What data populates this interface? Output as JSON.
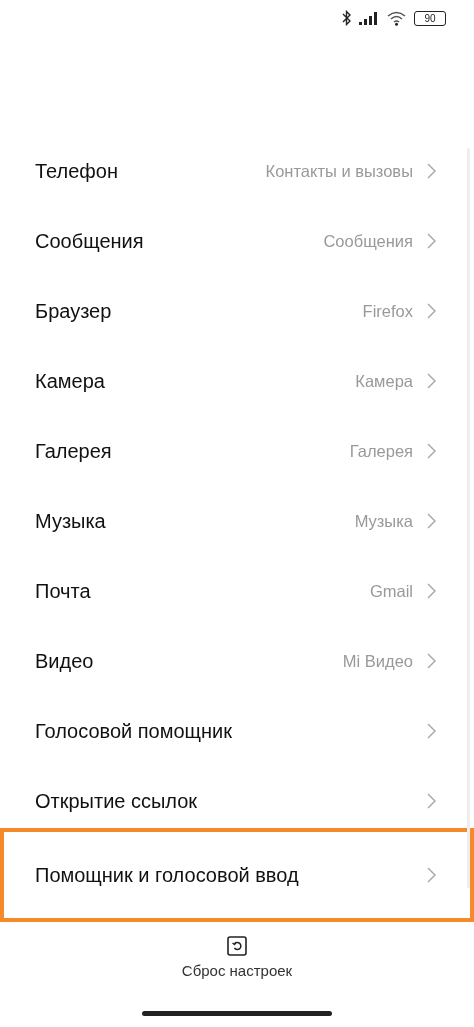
{
  "status_bar": {
    "battery": "90"
  },
  "items": [
    {
      "label": "Телефон",
      "value": "Контакты и вызовы",
      "highlighted": false
    },
    {
      "label": "Сообщения",
      "value": "Сообщения",
      "highlighted": false
    },
    {
      "label": "Браузер",
      "value": "Firefox",
      "highlighted": false
    },
    {
      "label": "Камера",
      "value": "Камера",
      "highlighted": false
    },
    {
      "label": "Галерея",
      "value": "Галерея",
      "highlighted": false
    },
    {
      "label": "Музыка",
      "value": "Музыка",
      "highlighted": false
    },
    {
      "label": "Почта",
      "value": "Gmail",
      "highlighted": false
    },
    {
      "label": "Видео",
      "value": "Mi Видео",
      "highlighted": false
    },
    {
      "label": "Голосовой помощник",
      "highlighted": false
    },
    {
      "label": "Открытие ссылок",
      "highlighted": false
    },
    {
      "label": "Помощник и голосовой ввод",
      "highlighted": true
    }
  ],
  "reset": {
    "label": "Сброс настроек"
  }
}
